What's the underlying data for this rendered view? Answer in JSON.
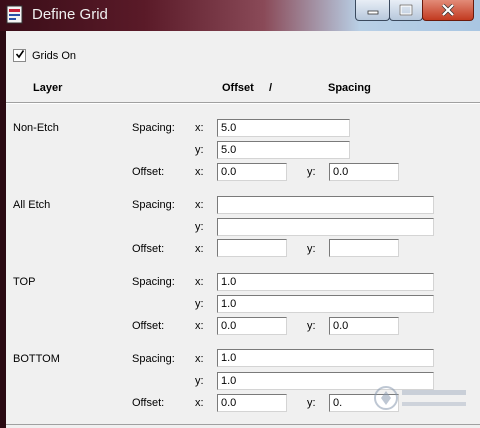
{
  "window": {
    "title": "Define Grid"
  },
  "grids_on": {
    "label": "Grids On",
    "checked": true
  },
  "headers": {
    "layer": "Layer",
    "offset": "Offset",
    "slash": "/",
    "spacing": "Spacing"
  },
  "labels": {
    "spacing": "Spacing:",
    "offset": "Offset:",
    "x": "x:",
    "y": "y:"
  },
  "layers": [
    {
      "name": "Non-Etch",
      "spacing_x": "5.0",
      "spacing_y": "5.0",
      "offset_x": "0.0",
      "offset_y": "0.0"
    },
    {
      "name": "All Etch",
      "spacing_x": "",
      "spacing_y": "",
      "offset_x": "",
      "offset_y": ""
    },
    {
      "name": "TOP",
      "spacing_x": "1.0",
      "spacing_y": "1.0",
      "offset_x": "0.0",
      "offset_y": "0.0"
    },
    {
      "name": "BOTTOM",
      "spacing_x": "1.0",
      "spacing_y": "1.0",
      "offset_x": "0.0",
      "offset_y": "0."
    }
  ],
  "icons": {
    "app": "app-icon",
    "minimize": "minimize-icon",
    "maximize": "maximize-icon",
    "close": "close-icon",
    "check": "checkmark-icon"
  }
}
